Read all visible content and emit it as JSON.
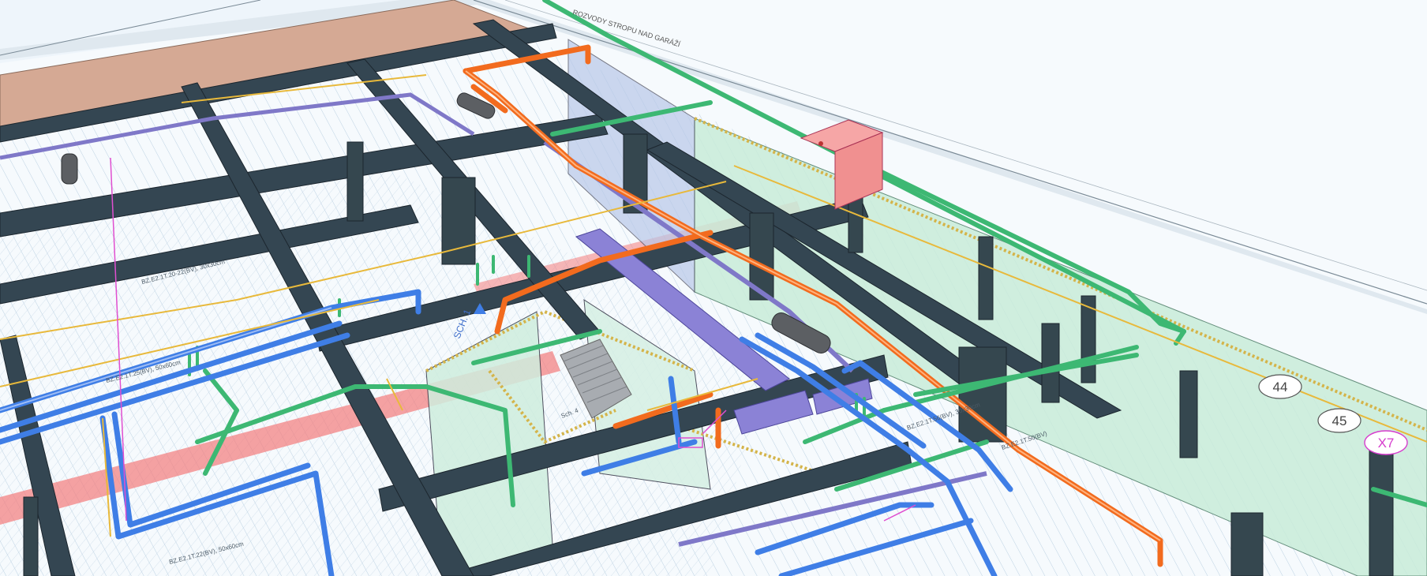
{
  "viewport": {
    "sheet_title": "ROZVODY STROPU NAD GARÁŽÍ",
    "grid_bubbles": [
      "44",
      "45",
      "X7"
    ],
    "room_labels": {
      "sch": "SCH. 1",
      "stair": "Sch. 4",
      "left_low": "BZ.E2.1T.22(BV), 50x60cm",
      "left_mid": "BZ.E2.1T.25(BV), 50x60cm",
      "left_up": "BZ.E2.1T.20-22(BV), 30x30cm",
      "right": "BZ.E2.1T.56(BV), 30x30cm",
      "right2": "BZ.E2.1T.50(BV)"
    }
  },
  "colors": {
    "background": "#eef5fb",
    "sheet": "#f8fbfd",
    "beam": "#344652",
    "beam_edge": "#1c262e",
    "wall_green": "#c9ecd9",
    "roof": "#d5a994",
    "hvac_orange": "#f26b1e",
    "water_blue": "#3f7ee6",
    "drain_green": "#3db873",
    "duct_purple": "#8b82d6",
    "fire_red": "#f47b7b",
    "gas_yellow": "#e8b93b",
    "annotation_magenta": "#e04fd0",
    "bubble_x7": "#d63ccd"
  }
}
